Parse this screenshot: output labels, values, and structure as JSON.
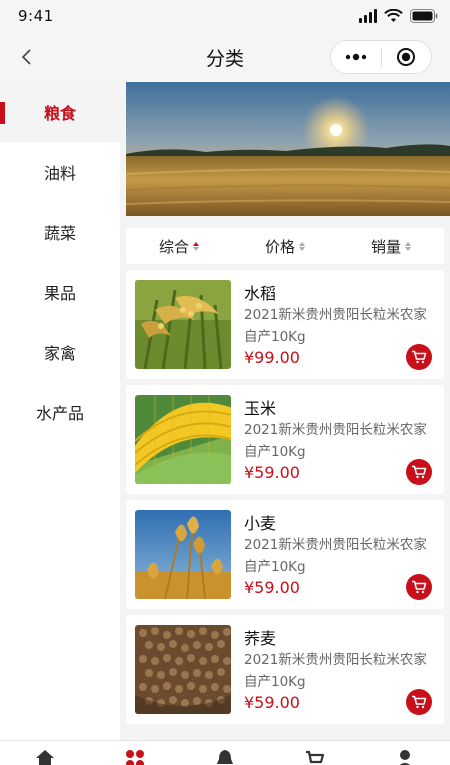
{
  "status_bar": {
    "time": "9:41"
  },
  "nav": {
    "title": "分类"
  },
  "sidebar": {
    "items": [
      {
        "label": "粮食"
      },
      {
        "label": "油料"
      },
      {
        "label": "蔬菜"
      },
      {
        "label": "果品"
      },
      {
        "label": "家禽"
      },
      {
        "label": "水产品"
      }
    ],
    "active_index": 0
  },
  "sort_bar": {
    "items": [
      {
        "label": "综合"
      },
      {
        "label": "价格"
      },
      {
        "label": "销量"
      }
    ]
  },
  "products": [
    {
      "name": "水稻",
      "desc": "2021新米贵州贵阳长粒米农家自产10Kg",
      "price": "¥99.00",
      "image": "rice-plant"
    },
    {
      "name": "玉米",
      "desc": "2021新米贵州贵阳长粒米农家自产10Kg",
      "price": "¥59.00",
      "image": "corn-cob"
    },
    {
      "name": "小麦",
      "desc": "2021新米贵州贵阳长粒米农家自产10Kg",
      "price": "¥59.00",
      "image": "wheat-ears"
    },
    {
      "name": "荞麦",
      "desc": "2021新米贵州贵阳长粒米农家自产10Kg",
      "price": "¥59.00",
      "image": "buckwheat-grains"
    }
  ],
  "colors": {
    "accent": "#c8101a",
    "background": "#f4f4f4"
  },
  "icons": {
    "nav": [
      "back-icon",
      "more-icon",
      "target-icon"
    ],
    "tabs": [
      "home-icon",
      "category-icon",
      "bell-icon",
      "cart-icon",
      "user-icon"
    ]
  }
}
